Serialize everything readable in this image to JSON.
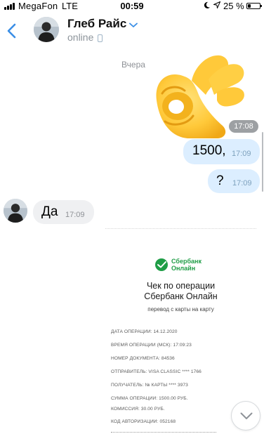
{
  "status_bar": {
    "carrier": "MegaFon",
    "network": "LTE",
    "time": "00:59",
    "battery_percent": "25 %",
    "battery_level": 0.25
  },
  "header": {
    "contact_name": "Глеб Райс",
    "status": "online"
  },
  "chat": {
    "date_separator": "Вчера",
    "sticker": {
      "name": "ok-hand-sticker",
      "time": "17:08"
    },
    "messages": [
      {
        "direction": "out",
        "text": "1500,",
        "time": "17:09"
      },
      {
        "direction": "out",
        "text": "?",
        "time": "17:09"
      },
      {
        "direction": "in",
        "text": "Да",
        "time": "17:09"
      }
    ]
  },
  "receipt": {
    "logo_line1": "Сбербанк",
    "logo_line2": "Онлайн",
    "title_line1": "Чек по операции",
    "title_line2": "Сбербанк Онлайн",
    "subtitle": "перевод с карты на карту",
    "lines": [
      "ДАТА ОПЕРАЦИИ: 14.12.2020",
      "ВРЕМЯ ОПЕРАЦИИ (МСК): 17:09:23",
      "НОМЕР ДОКУМЕНТА: 84536",
      "ОТПРАВИТЕЛЬ: VISA CLASSIC **** 1766",
      "ПОЛУЧАТЕЛЬ: № КАРТЫ **** 3973",
      "СУММА ОПЕРАЦИИ: 1500.00 РУБ.",
      "КОМИССИЯ: 30.00 РУБ.",
      "КОД АВТОРИЗАЦИИ: 052168"
    ]
  },
  "colors": {
    "accent": "#3a8ee6",
    "outgoing_bubble": "#dceeff",
    "incoming_bubble": "#eff0f2",
    "sberbank_green": "#1f9d46"
  },
  "icons": {
    "back": "chevron-left-icon",
    "name_dropdown": "chevron-down-icon",
    "status_device": "phone-icon",
    "scroll": "chevron-down-icon"
  }
}
